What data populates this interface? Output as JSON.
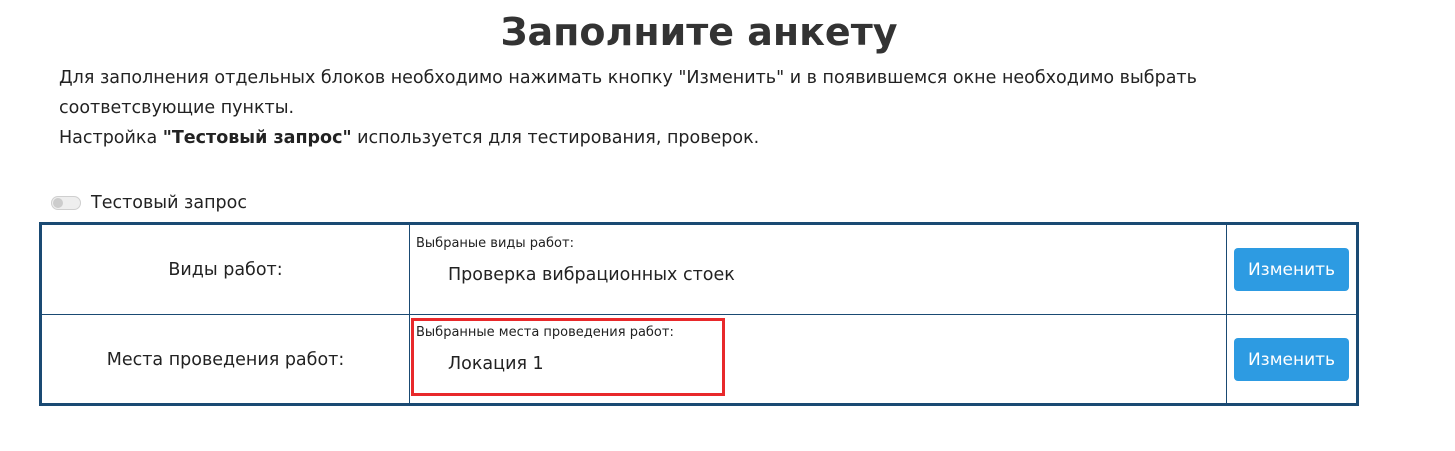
{
  "page": {
    "title": "Заполните анкету"
  },
  "intro": {
    "line1": "Для заполнения отдельных блоков необходимо нажимать кнопку \"Изменить\" и в появившемся окне необходимо выбрать",
    "line2": "соответсвующие пункты.",
    "line3_prefix": "Настройка ",
    "line3_bold": "\"Тестовый запрос\"",
    "line3_suffix": " используется для тестирования, проверок."
  },
  "test_toggle": {
    "label": "Тестовый запрос",
    "checked": false
  },
  "rows": [
    {
      "label": "Виды работ:",
      "caption": "Выбраные виды работ:",
      "value": "Проверка вибрационных стоек",
      "button_label": "Изменить"
    },
    {
      "label": "Места проведения работ:",
      "caption": "Выбранные места проведения работ:",
      "value": "Локация 1",
      "button_label": "Изменить"
    }
  ],
  "colors": {
    "table_border": "#1a4a73",
    "button": "#2d9be2",
    "highlight": "#e8292b"
  }
}
